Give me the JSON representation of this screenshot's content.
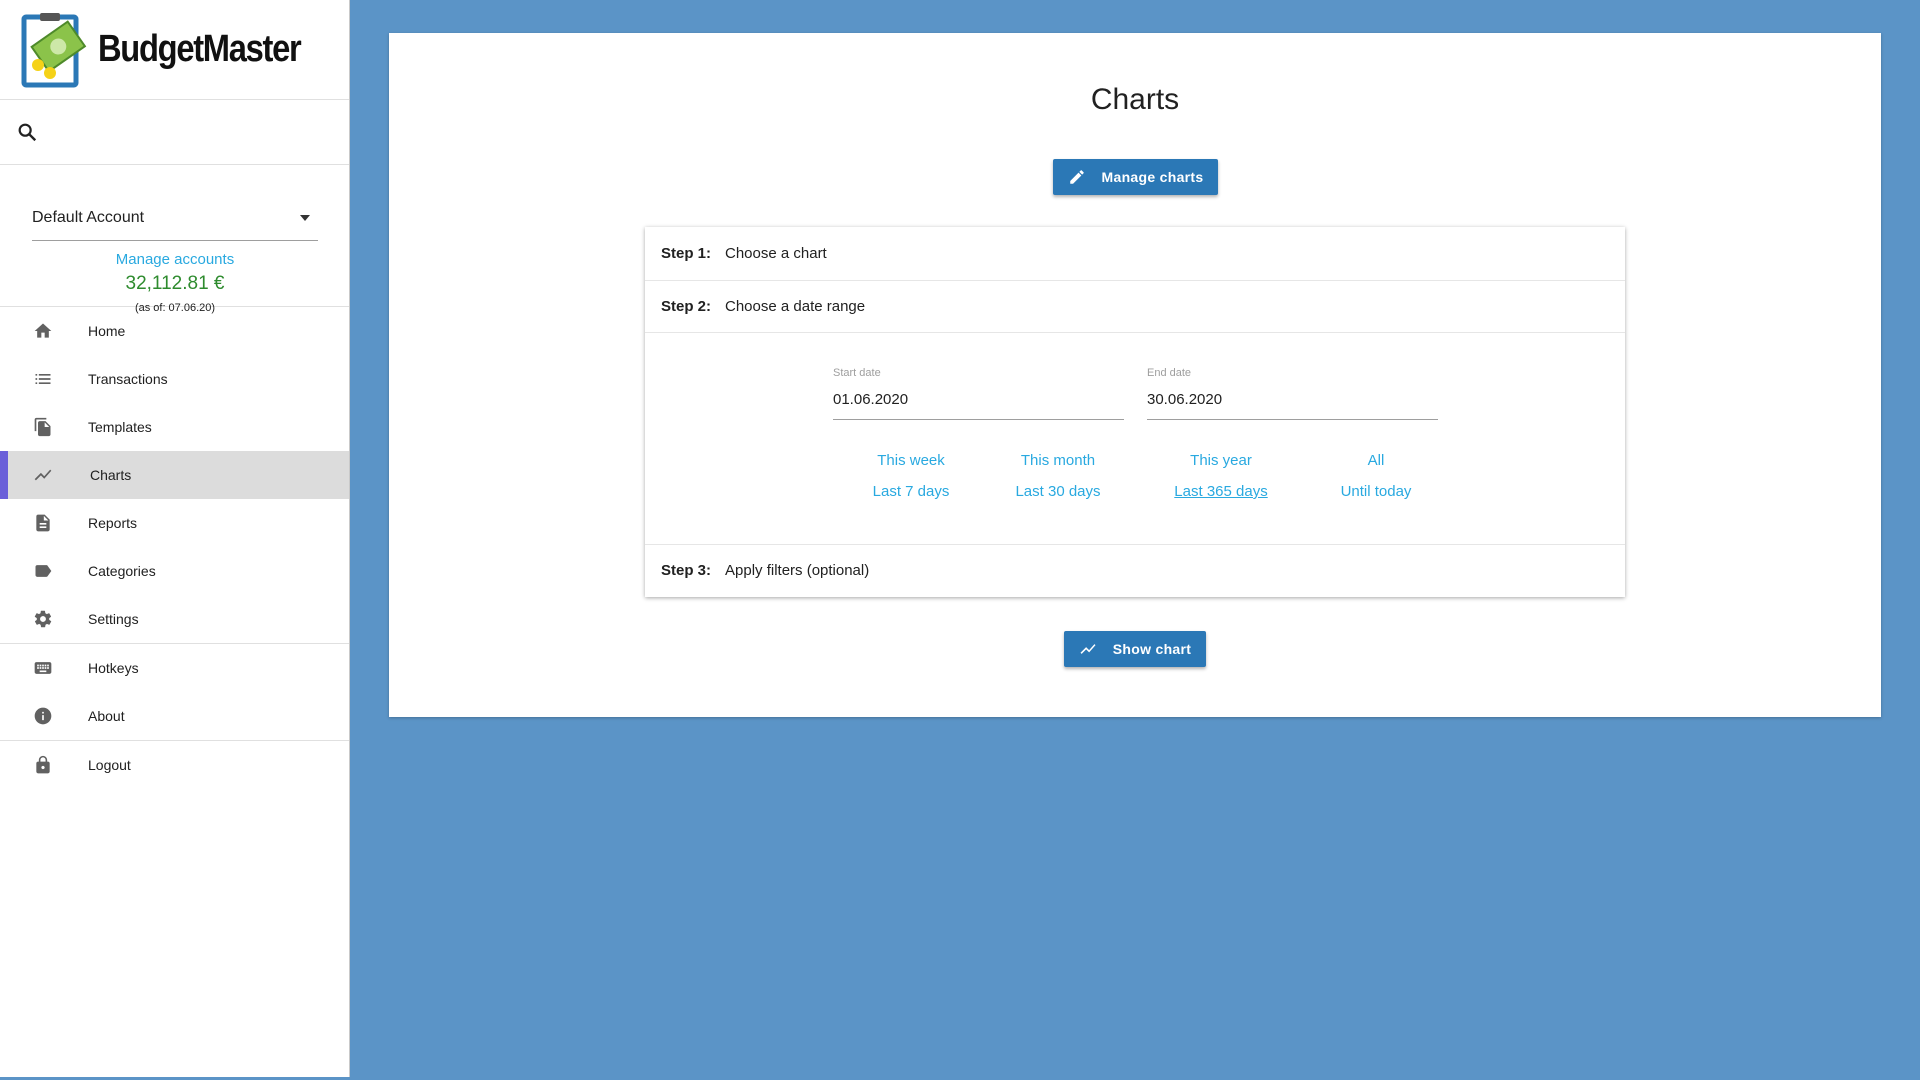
{
  "app": {
    "title": "BudgetMaster"
  },
  "account": {
    "selected": "Default Account",
    "manage_label": "Manage accounts",
    "balance": "32,112.81 €",
    "as_of": "(as of: 07.06.20)"
  },
  "nav": {
    "home": "Home",
    "transactions": "Transactions",
    "templates": "Templates",
    "charts": "Charts",
    "reports": "Reports",
    "categories": "Categories",
    "settings": "Settings",
    "hotkeys": "Hotkeys",
    "about": "About",
    "logout": "Logout"
  },
  "main": {
    "title": "Charts",
    "manage_button": "Manage charts",
    "show_button": "Show chart",
    "steps": {
      "s1_label": "Step 1:",
      "s1_text": "Choose a chart",
      "s2_label": "Step 2:",
      "s2_text": "Choose a date range",
      "s3_label": "Step 3:",
      "s3_text": "Apply filters (optional)"
    },
    "start_date": {
      "label": "Start date",
      "value": "01.06.2020"
    },
    "end_date": {
      "label": "End date",
      "value": "30.06.2020"
    },
    "quick": {
      "this_week": "This week",
      "this_month": "This month",
      "this_year": "This year",
      "all": "All",
      "last_7": "Last 7 days",
      "last_30": "Last 30 days",
      "last_365": "Last 365 days",
      "until_today": "Until today"
    }
  },
  "colors": {
    "accent": "#2b78b6",
    "background": "#5b94c7",
    "link": "#29a9e0",
    "balance": "#2e8b2e",
    "active_indicator": "#6a5fd9"
  },
  "icons": {
    "search": "search-icon",
    "home": "home-icon",
    "transactions": "list-icon",
    "templates": "copy-icon",
    "charts": "trending-icon",
    "reports": "document-icon",
    "categories": "label-icon",
    "settings": "gear-icon",
    "hotkeys": "keyboard-icon",
    "about": "info-icon",
    "logout": "lock-icon",
    "edit": "pencil-icon"
  }
}
